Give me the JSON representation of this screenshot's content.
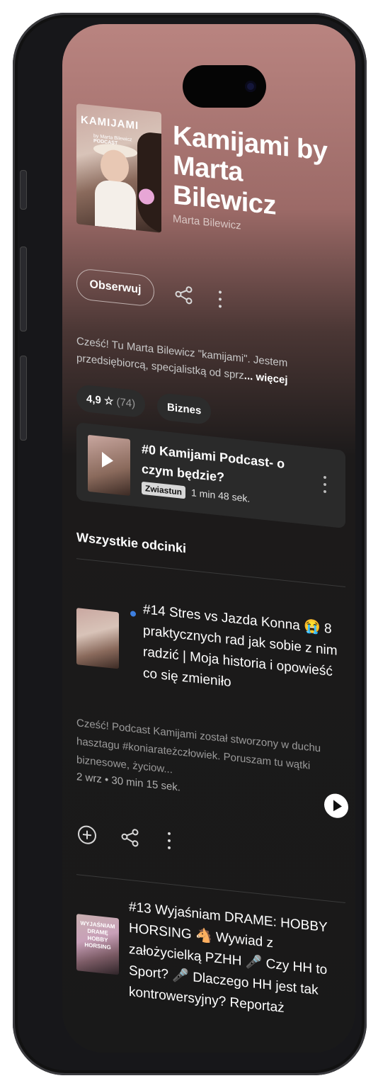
{
  "podcast": {
    "cover_title": "KAMIJAMI",
    "cover_subtitle": "by Marta Bilewicz",
    "cover_label": "PODCAST",
    "title": "Kamijami by Marta Bilewicz",
    "author": "Marta Bilewicz"
  },
  "actions": {
    "follow_label": "Obserwuj",
    "share_icon": "share-icon",
    "more_icon": "more-icon"
  },
  "description": {
    "text": "Cześć! Tu Marta Bilewicz \"kamijami\". Jestem przedsiębiorcą, specjalistką od sprz",
    "more_label": "... więcej"
  },
  "chips": {
    "rating": "4,9 ☆",
    "rating_count": "(74)",
    "category": "Biznes"
  },
  "trailer": {
    "title": "#0 Kamijami Podcast- o czym będzie?",
    "badge": "Zwiastun",
    "duration": "1 min 48 sek."
  },
  "episodes_section": {
    "title": "Wszystkie odcinki"
  },
  "episodes": [
    {
      "title": "#14 Stres vs Jazda Konna 😭 8 praktycznych rad jak sobie z nim radzić | Moja historia i opowieść co się zmieniło",
      "description": "Cześć! Podcast Kamijami został stworzony w duchu hasztagu #koniarateżczłowiek. Poruszam tu wątki biznesowe, życiow...",
      "meta": "2 wrz • 30 min 15 sek.",
      "is_new": true
    },
    {
      "title": "#13 Wyjaśniam DRAME: HOBBY HORSING 🐴 Wywiad z założycielką PZHH 🎤 Czy HH to Sport? 🎤 Dlaczego HH jest tak kontrowersyjny? Reportaż",
      "thumb_title": "WYJAŚNIAM DRAMĘ HOBBY HORSING"
    }
  ],
  "colors": {
    "header_top": "#b98480",
    "background": "#191919",
    "new_dot": "#3d7fe0"
  }
}
